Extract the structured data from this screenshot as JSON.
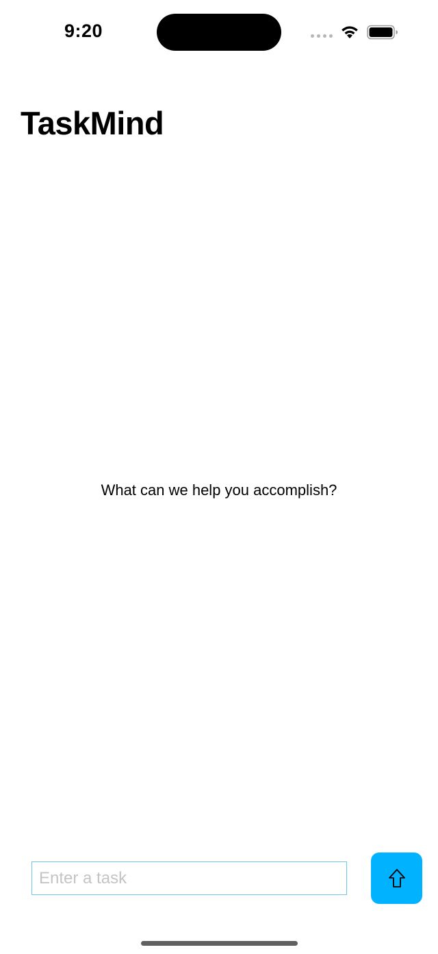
{
  "status_bar": {
    "time": "9:20",
    "icons": [
      "cellular-signal-icon",
      "wifi-icon",
      "battery-icon"
    ]
  },
  "header": {
    "title": "TaskMind"
  },
  "main": {
    "prompt": "What can we help you accomplish?"
  },
  "composer": {
    "input_value": "",
    "input_placeholder": "Enter a task",
    "submit_icon": "arrow-up-icon",
    "accent_color": "#00b2ff",
    "input_border_color": "#6dc7ea"
  }
}
